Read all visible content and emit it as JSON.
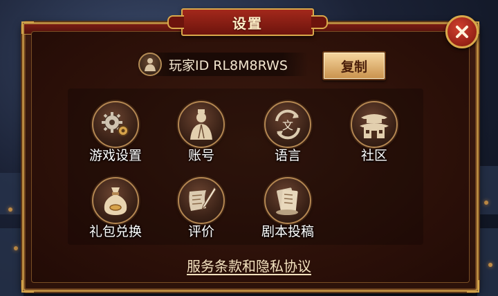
{
  "dialog": {
    "title": "设置",
    "player_id_label": "玩家ID RL8M8RWS",
    "copy_label": "复制",
    "close_icon": "close-icon"
  },
  "menu": {
    "items": [
      {
        "label": "游戏设置",
        "icon": "gears-icon"
      },
      {
        "label": "账号",
        "icon": "scholar-icon"
      },
      {
        "label": "语言",
        "icon": "language-icon"
      },
      {
        "label": "社区",
        "icon": "pavilion-icon"
      },
      {
        "label": "礼包兑换",
        "icon": "money-bag-icon"
      },
      {
        "label": "评价",
        "icon": "scroll-quill-icon"
      },
      {
        "label": "剧本投稿",
        "icon": "scroll-bundle-icon"
      }
    ]
  },
  "footer": {
    "terms_label": "服务条款和隐私协议"
  },
  "colors": {
    "panel": "#2c120a",
    "gold_border": "#b98a3f",
    "title_red": "#a3281b",
    "button_gold": "#e8b978"
  }
}
